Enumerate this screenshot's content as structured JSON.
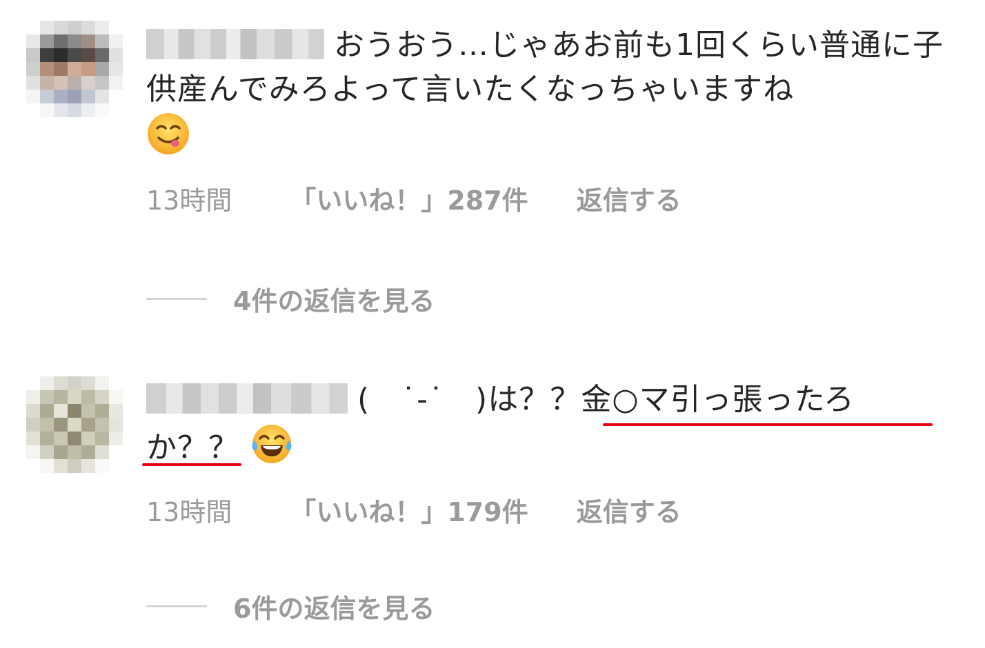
{
  "comments": [
    {
      "text_main": "おうおう…じゃあお前も1回くらい普通に子供産んでみろよって言いたくなっちゃいますね",
      "emoji": "face-savoring-food-emoji",
      "time": "13時間",
      "likes": "「いいね！」287件",
      "reply": "返信する",
      "view_replies": "4件の返信を見る"
    },
    {
      "text_before": "(　˙-˙　)は？？",
      "text_underlined_1": "金○マ引っ張ったろ",
      "text_underlined_2": "か？？",
      "emoji": "face-with-tears-of-joy-emoji",
      "time": "13時間",
      "likes": "「いいね！」179件",
      "reply": "返信する",
      "view_replies": "6件の返信を見る"
    }
  ],
  "colors": {
    "text": "#262626",
    "meta": "#9a9a9a",
    "underline": "#e60012"
  }
}
